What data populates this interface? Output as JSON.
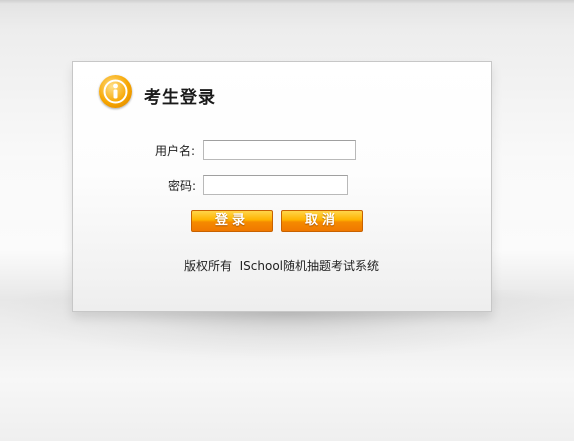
{
  "header": {
    "title": "考生登录",
    "logo_icon": "info-person-icon"
  },
  "form": {
    "username_label": "用户名:",
    "username_value": "",
    "password_label": "密码:",
    "password_value": ""
  },
  "buttons": {
    "login_label": "登录",
    "cancel_label": "取消"
  },
  "footer": {
    "copyright": "版权所有  ISchool随机抽题考试系统"
  },
  "colors": {
    "button_top": "#ffd54a",
    "button_bottom": "#f07800",
    "logo": "#f7a600"
  }
}
